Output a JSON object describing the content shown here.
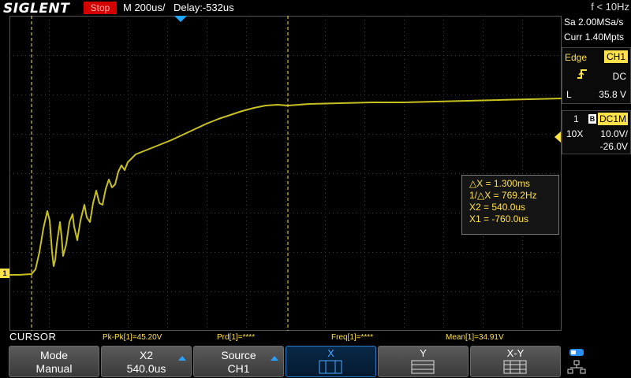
{
  "header": {
    "brand": "SIGLENT",
    "run_state": "Stop",
    "timebase": "M 200us/",
    "delay": "Delay:-532us"
  },
  "acquisition": {
    "trigger_freq": "f < 10Hz",
    "sample_rate": "Sa 2.00MSa/s",
    "memory_depth": "Curr 1.40Mpts"
  },
  "trigger": {
    "type": "Edge",
    "source": "CH1",
    "coupling": "DC",
    "level_label": "L",
    "level": "35.8 V"
  },
  "channel1": {
    "number": "1",
    "bw_limit_badge": "B",
    "coupling": "DC1M",
    "probe": "10X",
    "scale": "10.0V/",
    "offset": "-26.0V",
    "ground_marker": "1"
  },
  "cursors": {
    "delta_x": "△X = 1.300ms",
    "inv_delta_x": "1/△X = 769.2Hz",
    "x2": "X2 = 540.0us",
    "x1": "X1 = -760.0us"
  },
  "measurements": {
    "menu_title": "CURSOR",
    "pkpk": "Pk-Pk[1]=45.20V",
    "prd": "Prd[1]=****",
    "freq": "Freq[1]=****",
    "mean": "Mean[1]=34.91V"
  },
  "softkeys": {
    "mode_label": "Mode",
    "mode_value": "Manual",
    "x2_label": "X2",
    "x2_value": "540.0us",
    "source_label": "Source",
    "source_value": "CH1",
    "x_label": "X",
    "y_label": "Y",
    "xy_label": "X-Y"
  },
  "colors": {
    "trace": "#c8c020",
    "grid": "#4a4a4a",
    "cursor": "#ffe14a",
    "accent": "#2aa0ff"
  }
}
